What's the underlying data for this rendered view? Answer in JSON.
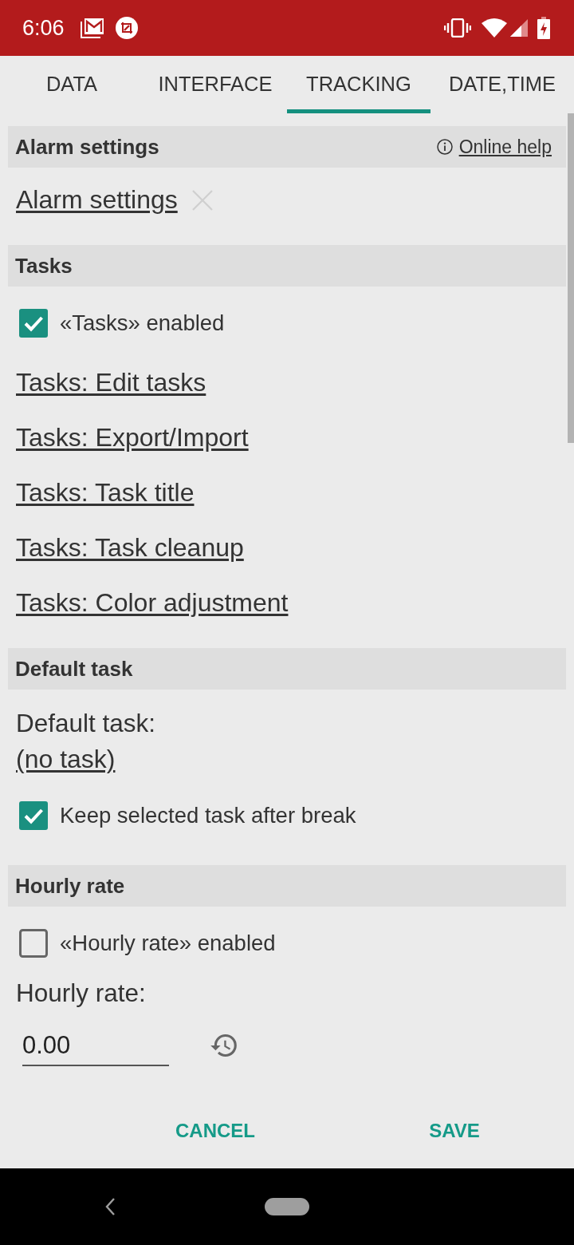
{
  "status_bar": {
    "time": "6:06"
  },
  "tabs": [
    {
      "label": "DATA",
      "selected": false
    },
    {
      "label": "INTERFACE",
      "selected": false
    },
    {
      "label": "TRACKING",
      "selected": true
    },
    {
      "label": "DATE,TIME",
      "selected": false
    }
  ],
  "sections": [
    {
      "header": "Alarm settings",
      "help_link": "Online help",
      "items": [
        {
          "kind": "link",
          "text": "Alarm settings",
          "clearable": true
        }
      ]
    },
    {
      "header": "Tasks",
      "items": [
        {
          "kind": "checkbox",
          "label": "«Tasks» enabled",
          "checked": true
        },
        {
          "kind": "link",
          "text": "Tasks: Edit tasks"
        },
        {
          "kind": "link",
          "text": "Tasks: Export/Import"
        },
        {
          "kind": "link",
          "text": "Tasks: Task title"
        },
        {
          "kind": "link",
          "text": "Tasks: Task cleanup"
        },
        {
          "kind": "link",
          "text": "Tasks: Color adjustment"
        }
      ]
    },
    {
      "header": "Default task",
      "items": [
        {
          "kind": "select",
          "label": "Default task:",
          "value": "(no task)"
        },
        {
          "kind": "checkbox",
          "label": "Keep selected task after break",
          "checked": true
        }
      ]
    },
    {
      "header": "Hourly rate",
      "items": [
        {
          "kind": "checkbox",
          "label": "«Hourly rate» enabled",
          "checked": false
        },
        {
          "kind": "label",
          "text": "Hourly rate:"
        },
        {
          "kind": "input",
          "value": "0.00"
        }
      ]
    }
  ],
  "buttons": [
    {
      "label": "CANCEL"
    },
    {
      "label": "SAVE"
    }
  ]
}
